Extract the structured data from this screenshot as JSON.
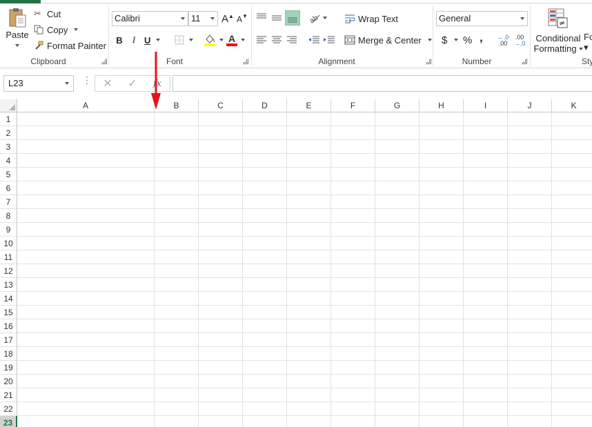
{
  "clipboard": {
    "paste_label": "Paste",
    "cut_label": "Cut",
    "copy_label": "Copy",
    "format_painter_label": "Format Painter",
    "group_label": "Clipboard"
  },
  "font": {
    "font_name": "Calibri",
    "font_size": "11",
    "bold": "B",
    "italic": "I",
    "underline": "U",
    "grow_label": "A",
    "shrink_label": "A",
    "font_color_label": "A",
    "group_label": "Font"
  },
  "alignment": {
    "wrap_text_label": "Wrap Text",
    "merge_center_label": "Merge & Center",
    "group_label": "Alignment"
  },
  "number": {
    "format": "General",
    "currency": "$",
    "percent": "%",
    "comma": ",",
    "inc_decimal_top": "←.0",
    "inc_decimal_bottom": ".00",
    "dec_decimal_top": ".00",
    "dec_decimal_bottom": "→.0",
    "group_label": "Number"
  },
  "styles": {
    "conditional_formatting_line1": "Conditional",
    "conditional_formatting_line2": "Formatting",
    "format_table_fragment": "Fo",
    "group_label_fragment": "Sty"
  },
  "formula_bar": {
    "name_box": "L23",
    "cancel": "✕",
    "enter": "✓",
    "fx": "fx",
    "formula": ""
  },
  "sheet": {
    "columns": [
      "A",
      "B",
      "C",
      "D",
      "E",
      "F",
      "G",
      "H",
      "I",
      "J",
      "K"
    ],
    "rows": [
      "1",
      "2",
      "3",
      "4",
      "5",
      "6",
      "7",
      "8",
      "9",
      "10",
      "11",
      "12",
      "13",
      "14",
      "15",
      "16",
      "17",
      "18",
      "19",
      "20",
      "21",
      "22",
      "23"
    ],
    "selected_row": "23",
    "selected_cell": "L23"
  },
  "colors": {
    "accent_green": "#217346",
    "annotation_red": "#e8131b",
    "fill_yellow": "#ffff00",
    "font_red": "#ff0000"
  }
}
